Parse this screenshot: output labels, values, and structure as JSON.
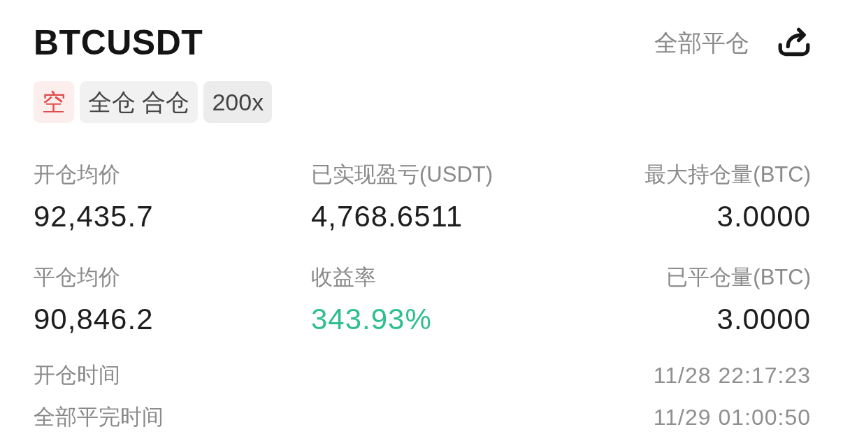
{
  "header": {
    "symbol": "BTCUSDT",
    "close_all": "全部平仓"
  },
  "tags": [
    {
      "label": "空",
      "kind": "side"
    },
    {
      "label": "全仓 合仓",
      "kind": "mode"
    },
    {
      "label": "200x",
      "kind": "leverage"
    }
  ],
  "stats": [
    {
      "label": "开仓均价",
      "value": "92,435.7",
      "positive": false
    },
    {
      "label": "已实现盈亏(USDT)",
      "value": "4,768.6511",
      "positive": false
    },
    {
      "label": "最大持仓量(BTC)",
      "value": "3.0000",
      "positive": false
    },
    {
      "label": "平仓均价",
      "value": "90,846.2",
      "positive": false
    },
    {
      "label": "收益率",
      "value": "343.93%",
      "positive": true
    },
    {
      "label": "已平仓量(BTC)",
      "value": "3.0000",
      "positive": false
    }
  ],
  "times": [
    {
      "label": "开仓时间",
      "value": "11/28 22:17:23"
    },
    {
      "label": "全部平完时间",
      "value": "11/29 01:00:50"
    }
  ]
}
